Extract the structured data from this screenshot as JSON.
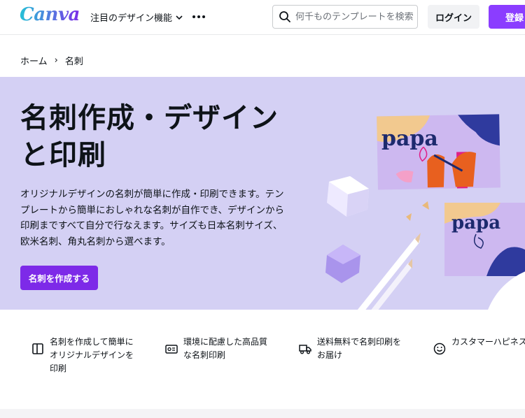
{
  "header": {
    "logo": "Canva",
    "features_menu": "注目のデザイン機能",
    "search_placeholder": "何千ものテンプレートを検索",
    "login_label": "ログイン",
    "signup_label": "登録"
  },
  "breadcrumb": {
    "home": "ホーム",
    "separator": "›",
    "current": "名刺"
  },
  "hero": {
    "title": "名刺作成・デザインと印刷",
    "description": "オリジナルデザインの名刺が簡単に作成・印刷できます。テンプレートから簡単におしゃれな名刺が自作でき、デザインから印刷まですべて自分で行なえます。サイズも日本名刺サイズ、欧米名刺、角丸名刺から選べます。",
    "cta_label": "名刺を作成する",
    "card_text_1": "papa",
    "card_text_2": "papa",
    "background_color": "#d4d0f4",
    "accent_color": "#7d2ae8"
  },
  "features": [
    {
      "icon": "layout-icon",
      "text": "名刺を作成して簡単にオリジナルデザインを印刷"
    },
    {
      "icon": "id-card-icon",
      "text": "環境に配慮した高品質な名刺印刷"
    },
    {
      "icon": "truck-icon",
      "text": "送料無料で名刺印刷をお届け"
    },
    {
      "icon": "smile-icon",
      "text": "カスタマーハピネス追求"
    }
  ]
}
